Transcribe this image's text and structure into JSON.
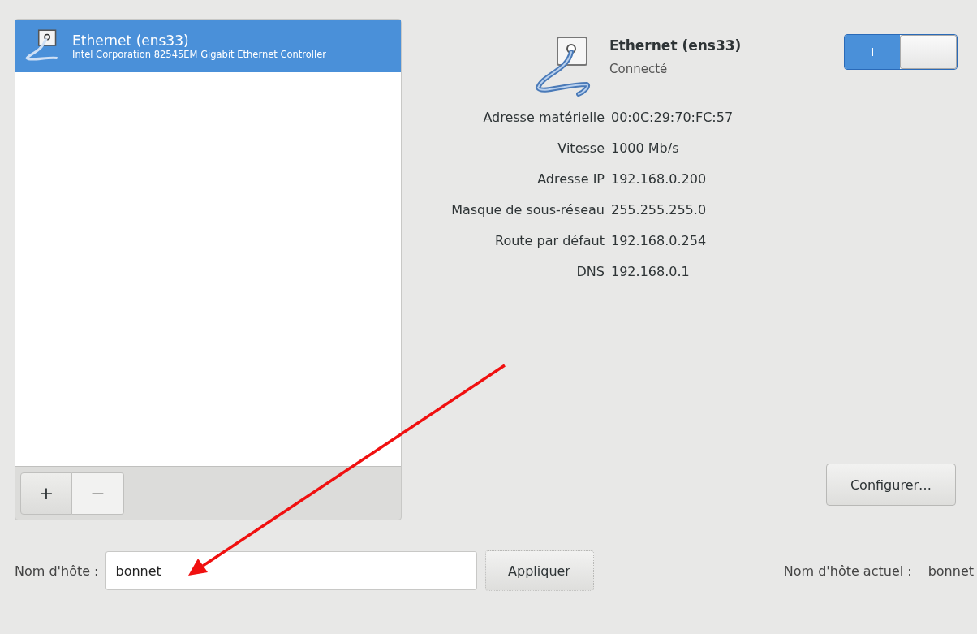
{
  "devices": [
    {
      "name": "Ethernet (ens33)",
      "description": "Intel Corporation 82545EM Gigabit Ethernet Controller",
      "selected": true
    }
  ],
  "list_buttons": [
    {
      "label": "+",
      "disabled": false
    },
    {
      "label": "−",
      "disabled": true
    }
  ],
  "detail": {
    "name": "Ethernet (ens33)",
    "status": "Connecté",
    "switch": {
      "on": true
    },
    "properties": [
      {
        "label": "Adresse matérielle",
        "value": "00:0C:29:70:FC:57"
      },
      {
        "label": "Vitesse",
        "value": "1000 Mb/s"
      },
      {
        "label": "Adresse IP",
        "value": "192.168.0.200"
      },
      {
        "label": "Masque de sous-réseau",
        "value": "255.255.255.0"
      },
      {
        "label": "Route par défaut",
        "value": "192.168.0.254"
      },
      {
        "label": "DNS",
        "value": "192.168.0.1"
      }
    ],
    "configure_button": "Configurer…"
  },
  "hostname": {
    "label": "Nom d'hôte :",
    "value": "bonnet",
    "apply_button": "Appliquer",
    "current_label": "Nom d'hôte actuel :",
    "current_value": "bonnet"
  }
}
